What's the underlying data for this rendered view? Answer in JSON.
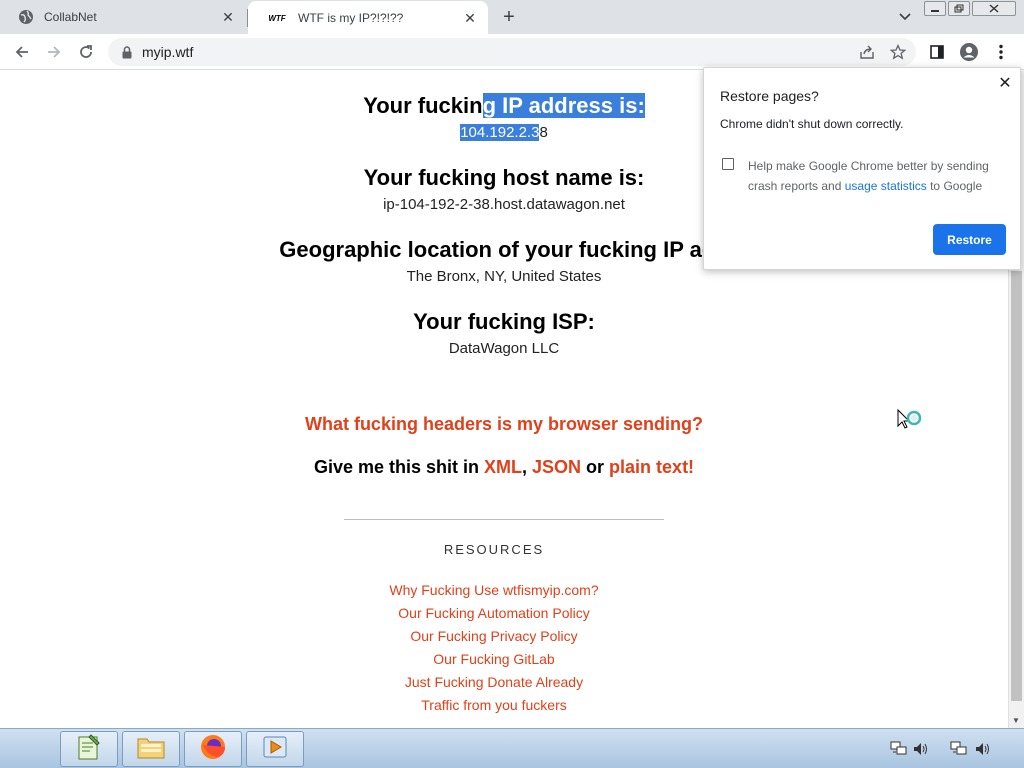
{
  "browser": {
    "tabs": [
      {
        "title": "CollabNet",
        "active": false
      },
      {
        "title": "WTF is my IP?!?!??",
        "favicon_text": "WTF",
        "active": true
      }
    ],
    "url": "myip.wtf"
  },
  "page": {
    "ip_heading_pre": "Your fuckin",
    "ip_heading_sel": "g IP address is:",
    "ip_value_sel": "104.192.2.3",
    "ip_value_rest": "8",
    "host_heading": "Your fucking host name is:",
    "host_value": "ip-104-192-2-38.host.datawagon.net",
    "geo_heading": "Geographic location of your fucking IP add",
    "geo_value": "The Bronx, NY, United States",
    "isp_heading": "Your fucking ISP:",
    "isp_value": "DataWagon LLC",
    "headers_link": "What fucking headers is my browser sending?",
    "give_pre": "Give me this shit in ",
    "give_xml": "XML",
    "give_sep1": ", ",
    "give_json": "JSON",
    "give_or": " or ",
    "give_plain": "plain text!",
    "resources_heading": "RESOURCES",
    "resources_links": [
      "Why Fucking Use wtfismyip.com?",
      "Our Fucking Automation Policy",
      "Our Fucking Privacy Policy",
      "Our Fucking GitLab",
      "Just Fucking Donate Already",
      "Traffic from you fuckers"
    ]
  },
  "popup": {
    "title": "Restore pages?",
    "message": "Chrome didn't shut down correctly.",
    "checkbox_text_pre": "Help make Google Chrome better by sending crash reports and ",
    "checkbox_link": "usage statistics",
    "checkbox_text_post": " to Google",
    "checkbox_checked": false,
    "restore_label": "Restore"
  },
  "colors": {
    "accent_red": "#e0401a",
    "selection": "#3b7fdc",
    "button_blue": "#1a73e8"
  }
}
